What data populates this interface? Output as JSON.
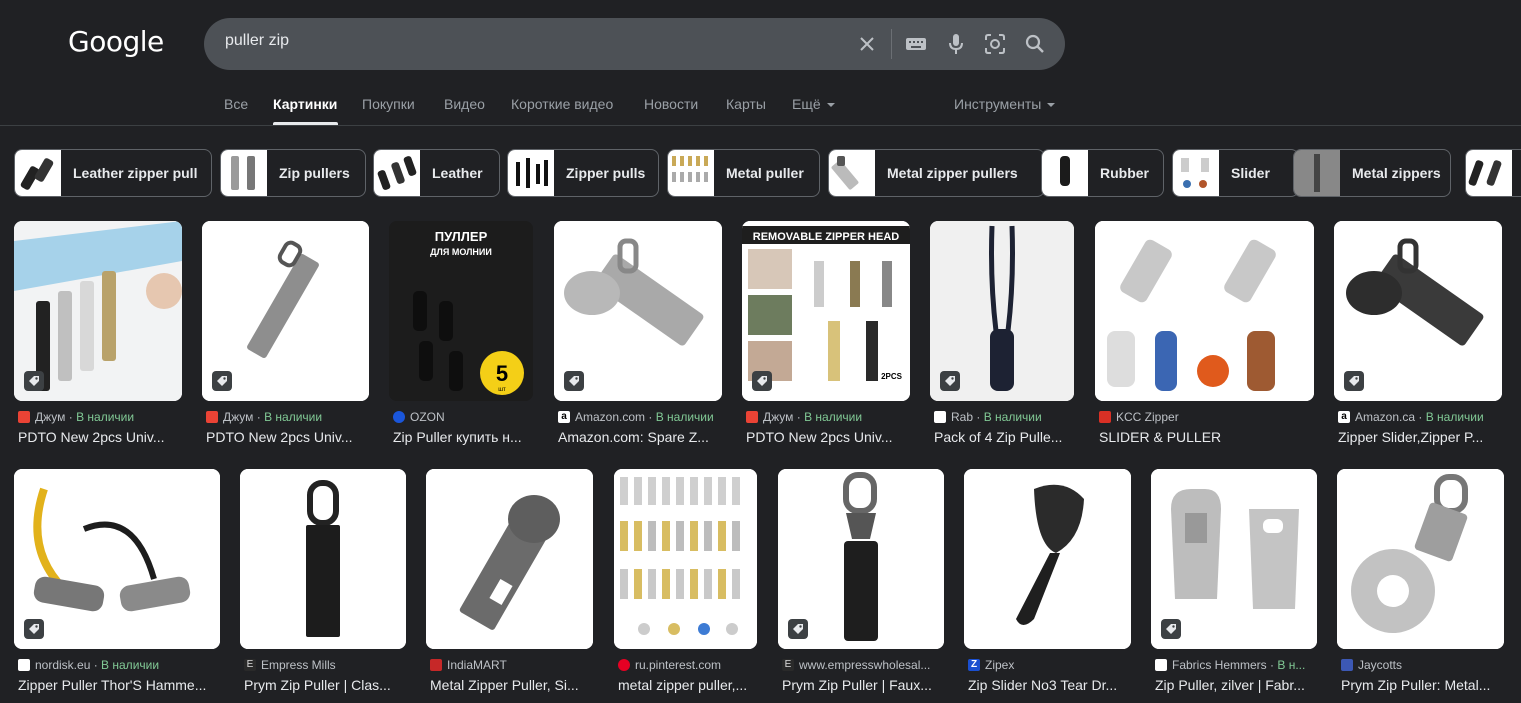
{
  "logo": "Google",
  "search": {
    "query": "puller zip"
  },
  "tabs": [
    {
      "label": "Все"
    },
    {
      "label": "Картинки"
    },
    {
      "label": "Покупки"
    },
    {
      "label": "Видео"
    },
    {
      "label": "Короткие видео"
    },
    {
      "label": "Новости"
    },
    {
      "label": "Карты"
    },
    {
      "label": "Ещё"
    }
  ],
  "tools_label": "Инструменты",
  "chips": [
    {
      "label": "Leather zipper pull"
    },
    {
      "label": "Zip pullers"
    },
    {
      "label": "Leather"
    },
    {
      "label": "Zipper pulls"
    },
    {
      "label": "Metal puller"
    },
    {
      "label": "Metal zipper pullers"
    },
    {
      "label": "Rubber"
    },
    {
      "label": "Slider"
    },
    {
      "label": "Metal zippers"
    }
  ],
  "results": [
    {
      "source": "Джум",
      "stock": "В наличии",
      "title": "PDTO New 2pcs Univ..."
    },
    {
      "source": "Джум",
      "stock": "В наличии",
      "title": "PDTO New 2pcs Univ..."
    },
    {
      "source": "OZON",
      "stock": "",
      "title": "Zip Puller купить н...",
      "image_text": {
        "line1": "ПУЛЛЕР",
        "line2": "ДЛЯ МОЛНИИ",
        "badge": "5",
        "badge_sub": "шт"
      }
    },
    {
      "source": "Amazon.com",
      "stock": "В наличии",
      "title": "Amazon.com: Spare Z..."
    },
    {
      "source": "Джум",
      "stock": "В наличии",
      "title": "PDTO New 2pcs Univ...",
      "image_text": {
        "banner": "REMOVABLE ZIPPER HEAD",
        "corner": "2PCS"
      }
    },
    {
      "source": "Rab",
      "stock": "В наличии",
      "title": "Pack of 4 Zip Pulle..."
    },
    {
      "source": "KCC Zipper",
      "stock": "",
      "title": "SLIDER & PULLER"
    },
    {
      "source": "Amazon.ca",
      "stock": "В наличии",
      "title": "Zipper Slider,Zipper P..."
    },
    {
      "source": "nordisk.eu",
      "stock": "В наличии",
      "title": "Zipper Puller Thor'S Hamme..."
    },
    {
      "source": "Empress Mills",
      "stock": "",
      "title": "Prym Zip Puller | Clas..."
    },
    {
      "source": "IndiaMART",
      "stock": "",
      "title": "Metal Zipper Puller, Si..."
    },
    {
      "source": "ru.pinterest.com",
      "stock": "",
      "title": "metal zipper puller,..."
    },
    {
      "source": "www.empresswholesal...",
      "stock": "",
      "title": "Prym Zip Puller | Faux..."
    },
    {
      "source": "Zipex",
      "stock": "",
      "title": "Zip Slider No3 Tear Dr..."
    },
    {
      "source": "Fabrics Hemmers",
      "stock": "В н...",
      "title": "Zip Puller, zilver | Fabr..."
    },
    {
      "source": "Jaycotts",
      "stock": "",
      "title": "Prym Zip Puller: Metal..."
    }
  ],
  "colors": {
    "background": "#202124",
    "searchbox": "#4d5156",
    "in_stock": "#81c995",
    "text_secondary": "#bdc1c6"
  },
  "icons": [
    "clear-icon",
    "keyboard-icon",
    "microphone-icon",
    "lens-icon",
    "search-icon",
    "shopping-tag-icon"
  ]
}
